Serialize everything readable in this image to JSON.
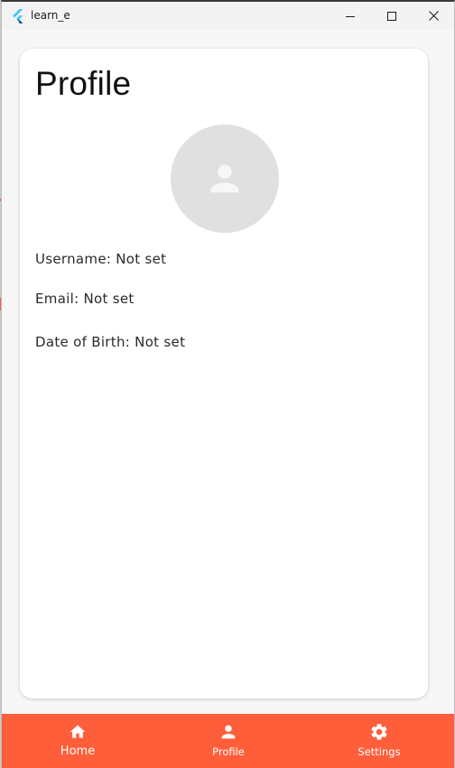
{
  "window": {
    "title": "learn_e"
  },
  "profile": {
    "title": "Profile",
    "username_line": "Username: Not set",
    "email_line": "Email: Not set",
    "dob_line": "Date of Birth: Not set",
    "avatar_icon": "person-icon"
  },
  "bottom_nav": {
    "items": [
      {
        "label": "Home",
        "icon": "home-icon"
      },
      {
        "label": "Profile",
        "icon": "person-icon"
      },
      {
        "label": "Settings",
        "icon": "gear-icon"
      }
    ]
  },
  "colors": {
    "accent": "#ff5e3a",
    "avatar_bg": "#e0e0e0",
    "avatar_fg": "#f7f7f7",
    "flutter_blue": "#47c5fb",
    "flutter_navy": "#00569e"
  }
}
